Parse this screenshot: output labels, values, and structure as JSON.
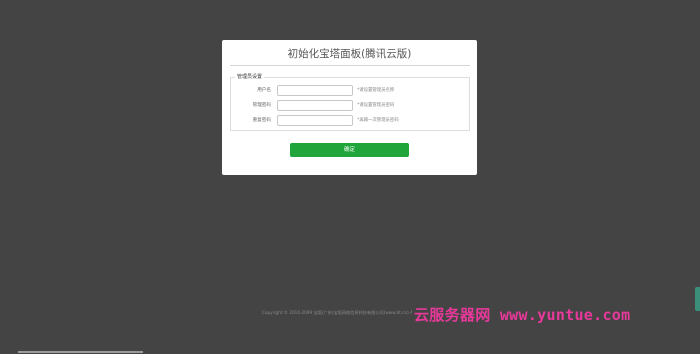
{
  "panel": {
    "title": "初始化宝塔面板(腾讯云版)",
    "section_legend": "管理员设置",
    "fields": [
      {
        "label": "用户名",
        "value": "",
        "hint": "*请设置管理员名称"
      },
      {
        "label": "管理密码",
        "value": "",
        "hint": "*请设置管理员密码"
      },
      {
        "label": "重复密码",
        "value": "",
        "hint": "*再输一次管理员密码"
      }
    ],
    "submit_label": "确定"
  },
  "footer": {
    "copyright": "Copyright © 2014-2099 宝塔(广东)宝塔网络信息科技有限公司(www.bt.cn) All Rights Reserved"
  },
  "watermark": {
    "text": "云服务器网 www.yuntue.com",
    "color": "#e8399b"
  },
  "colors": {
    "background": "#444444",
    "accent": "#20a53a"
  }
}
